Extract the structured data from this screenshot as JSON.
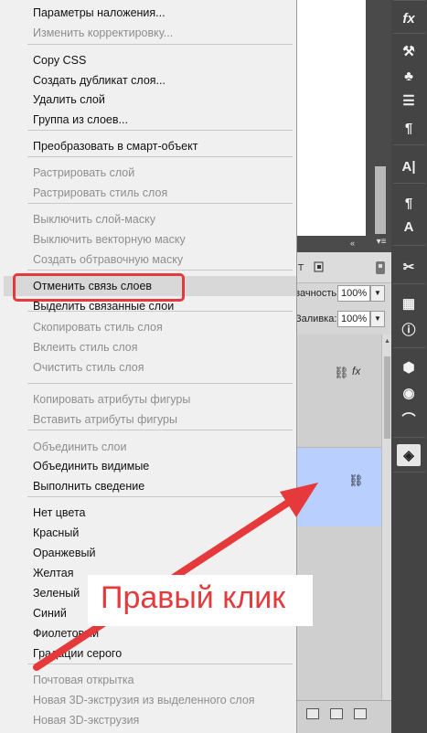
{
  "context_menu": {
    "items": [
      {
        "label": "Параметры наложения...",
        "enabled": true
      },
      {
        "label": "Изменить корректировку...",
        "enabled": false
      },
      {
        "label": "Copy CSS",
        "enabled": true
      },
      {
        "label": "Создать дубликат слоя...",
        "enabled": true
      },
      {
        "label": "Удалить слой",
        "enabled": true
      },
      {
        "label": "Группа из слоев...",
        "enabled": true
      },
      {
        "label": "Преобразовать в смарт-объект",
        "enabled": true
      },
      {
        "label": "Растрировать слой",
        "enabled": false
      },
      {
        "label": "Растрировать стиль слоя",
        "enabled": false
      },
      {
        "label": "Выключить слой-маску",
        "enabled": false
      },
      {
        "label": "Выключить векторную маску",
        "enabled": false
      },
      {
        "label": "Создать обтравочную маску",
        "enabled": false
      },
      {
        "label": "Отменить связь слоев",
        "enabled": true,
        "highlighted": true
      },
      {
        "label": "Выделить связанные слои",
        "enabled": true
      },
      {
        "label": "Скопировать стиль слоя",
        "enabled": false
      },
      {
        "label": "Вклеить стиль слоя",
        "enabled": false
      },
      {
        "label": "Очистить стиль слоя",
        "enabled": false
      },
      {
        "label": "Копировать атрибуты фигуры",
        "enabled": false
      },
      {
        "label": "Вставить атрибуты фигуры",
        "enabled": false
      },
      {
        "label": "Объединить слои",
        "enabled": false
      },
      {
        "label": "Объединить видимые",
        "enabled": true
      },
      {
        "label": "Выполнить сведение",
        "enabled": true
      },
      {
        "label": "Нет цвета",
        "enabled": true
      },
      {
        "label": "Красный",
        "enabled": true
      },
      {
        "label": "Оранжевый",
        "enabled": true
      },
      {
        "label": "Желтая",
        "enabled": true
      },
      {
        "label": "Зеленый",
        "enabled": true
      },
      {
        "label": "Синий",
        "enabled": true
      },
      {
        "label": "Фиолетовый",
        "enabled": true
      },
      {
        "label": "Градации серого",
        "enabled": true
      },
      {
        "label": "Почтовая открытка",
        "enabled": false
      },
      {
        "label": "Новая 3D-экструзия из выделенного слоя",
        "enabled": false
      },
      {
        "label": "Новая 3D-экструзия",
        "enabled": false
      }
    ]
  },
  "layers_panel": {
    "opacity_label": "зачность:",
    "opacity_value": "100%",
    "fill_label": "Заливка:",
    "fill_value": "100%",
    "fx_label": "fx",
    "link_icon": "link-icon"
  },
  "annotation": {
    "callout_text": "Правый клик",
    "accent_color": "#e6393b"
  },
  "tool_strip": {
    "icons": [
      "fx-icon",
      "brush-settings-icon",
      "clone-source-icon",
      "align-icon",
      "paragraph-icon",
      "character-icon",
      "type-paragraph-style-icon",
      "character-style-icon",
      "tool-presets-icon",
      "adjustments-icon",
      "info-icon",
      "3d-icon",
      "channels-icon",
      "paths-icon",
      "layers-icon"
    ]
  }
}
